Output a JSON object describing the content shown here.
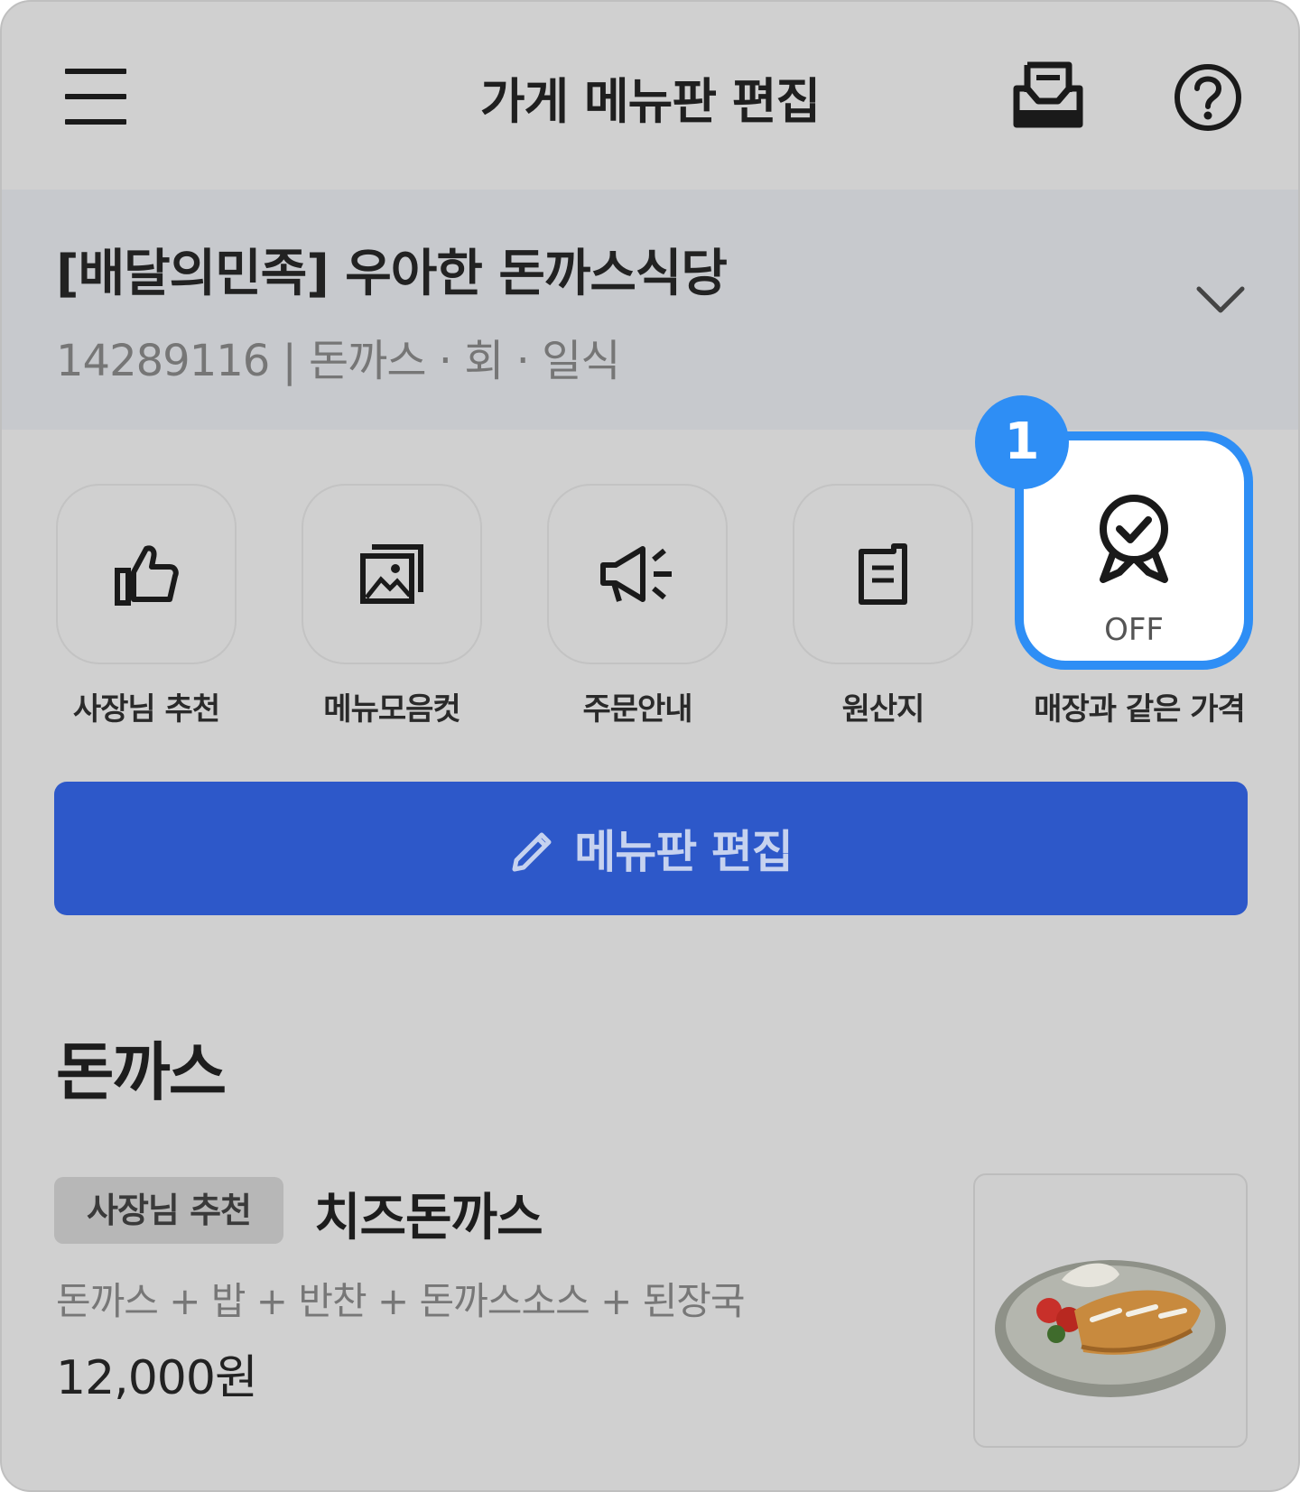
{
  "header": {
    "title": "가게 메뉴판 편집",
    "icons": [
      "hamburger-menu-icon",
      "inbox-icon",
      "help-icon"
    ]
  },
  "store": {
    "name": "[배달의민족] 우아한 돈까스식당",
    "info": "14289116 | 돈까스 · 회 · 일식"
  },
  "quick_actions": [
    {
      "label": "사장님 추천",
      "icon": "thumbs-up-icon"
    },
    {
      "label": "메뉴모음컷",
      "icon": "photo-gallery-icon"
    },
    {
      "label": "주문안내",
      "icon": "megaphone-icon"
    },
    {
      "label": "원산지",
      "icon": "document-icon"
    },
    {
      "label": "매장과 같은 가격",
      "icon": "badge-check-icon",
      "status": "OFF",
      "step_badge": "1"
    }
  ],
  "edit_button": {
    "label": "메뉴판 편집",
    "icon": "pencil-icon"
  },
  "category": {
    "title": "돈까스"
  },
  "menu_item": {
    "tag": "사장님 추천",
    "name": "치즈돈까스",
    "description": "돈까스 + 밥 + 반찬 + 돈까스소스 + 된장국",
    "price": "12,000원"
  },
  "colors": {
    "accent_blue": "#2e8ef5",
    "primary_button": "#2d58c9",
    "overlay_gray": "#d0d0d0"
  }
}
